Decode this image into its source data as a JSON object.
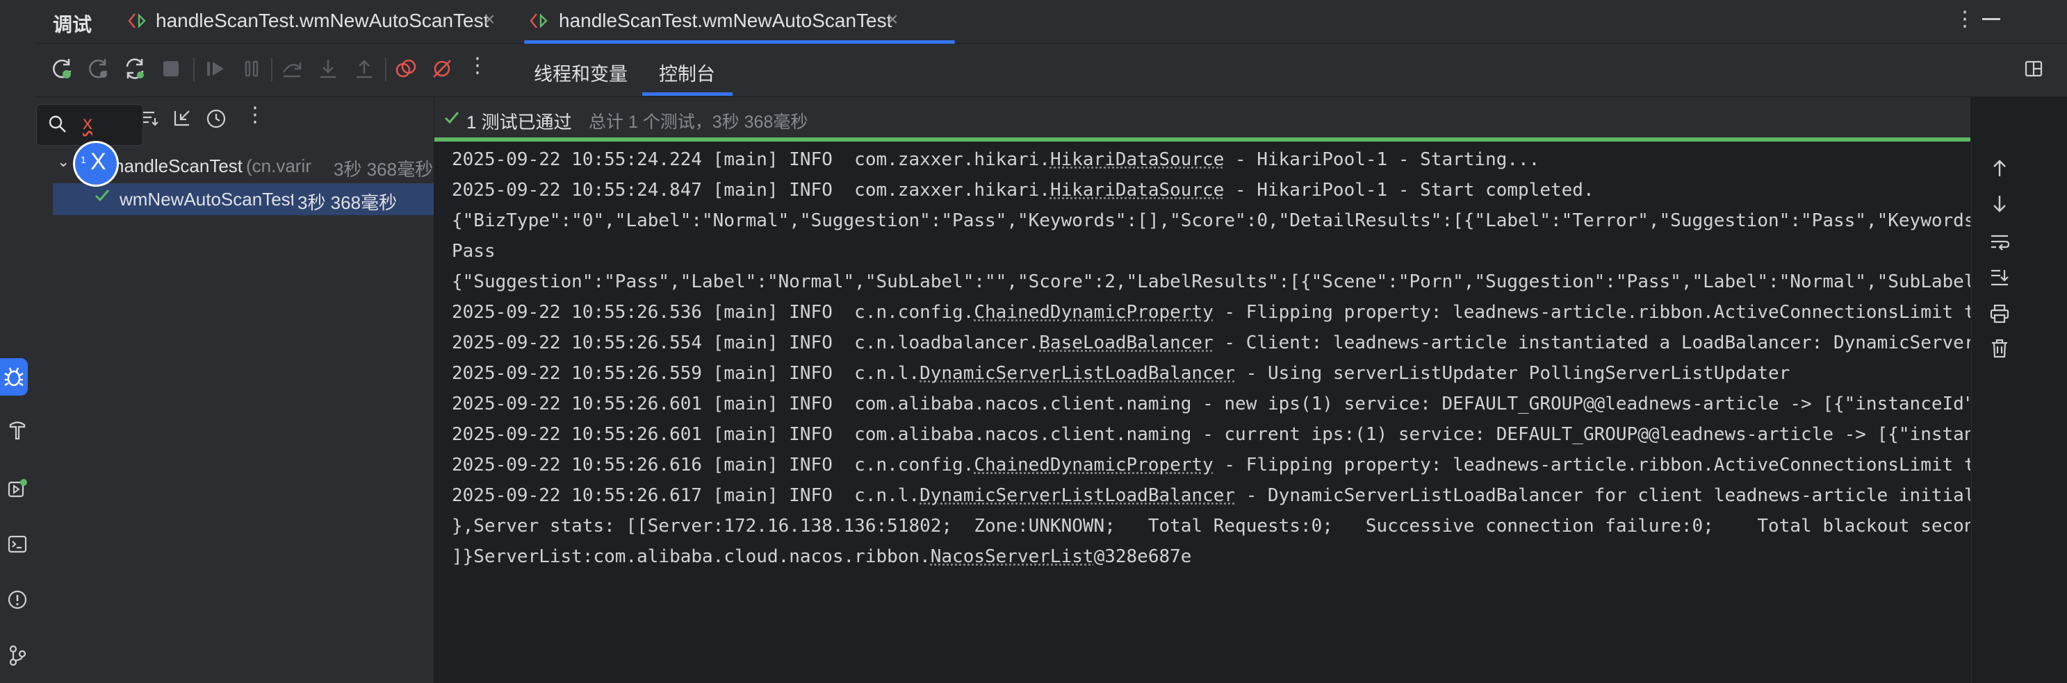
{
  "tabs": {
    "debug_label": "调试",
    "items": [
      {
        "label": "handleScanTest.wmNewAutoScanTest",
        "active": false
      },
      {
        "label": "handleScanTest.wmNewAutoScanTest",
        "active": true
      }
    ]
  },
  "toolbar": {
    "tabs": [
      {
        "label": "线程和变量",
        "active": false
      },
      {
        "label": "控制台",
        "active": true
      }
    ]
  },
  "search": {
    "value": "x"
  },
  "badge": {
    "count": "1",
    "label": "X"
  },
  "tree": {
    "root": {
      "name": "handleScanTest",
      "package": "(cn.varir",
      "time": "3秒 368毫秒"
    },
    "child": {
      "name": "wmNewAutoScanTest",
      "time": "3秒 368毫秒"
    }
  },
  "status": {
    "passed": "1 测试已通过",
    "summary": "总计 1 个测试，3秒 368毫秒"
  },
  "console": {
    "lines": [
      {
        "pre": "2025-09-22 10:55:24.224 [main] INFO  com.zaxxer.hikari.",
        "link": "HikariDataSource",
        "post": " - HikariPool-1 - Starting..."
      },
      {
        "pre": "2025-09-22 10:55:24.847 [main] INFO  com.zaxxer.hikari.",
        "link": "HikariDataSource",
        "post": " - HikariPool-1 - Start completed."
      },
      {
        "pre": "{\"BizType\":\"0\",\"Label\":\"Normal\",\"Suggestion\":\"Pass\",\"Keywords\":[],\"Score\":0,\"DetailResults\":[{\"Label\":\"Terror\",\"Suggestion\":\"Pass\",\"Keywords",
        "link": "",
        "post": ""
      },
      {
        "pre": "Pass",
        "link": "",
        "post": ""
      },
      {
        "pre": "{\"Suggestion\":\"Pass\",\"Label\":\"Normal\",\"SubLabel\":\"\",\"Score\":2,\"LabelResults\":[{\"Scene\":\"Porn\",\"Suggestion\":\"Pass\",\"Label\":\"Normal\",\"SubLabel",
        "link": "",
        "post": ""
      },
      {
        "pre": "2025-09-22 10:55:26.536 [main] INFO  c.n.config.",
        "link": "ChainedDynamicProperty",
        "post": " - Flipping property: leadnews-article.ribbon.ActiveConnectionsLimit t"
      },
      {
        "pre": "2025-09-22 10:55:26.554 [main] INFO  c.n.loadbalancer.",
        "link": "BaseLoadBalancer",
        "post": " - Client: leadnews-article instantiated a LoadBalancer: DynamicServer"
      },
      {
        "pre": "2025-09-22 10:55:26.559 [main] INFO  c.n.l.",
        "link": "DynamicServerListLoadBalancer",
        "post": " - Using serverListUpdater PollingServerListUpdater"
      },
      {
        "pre": "2025-09-22 10:55:26.601 [main] INFO  com.alibaba.nacos.client.naming - new ips(1) service: DEFAULT_GROUP@@leadnews-article -> [{\"instanceId\"",
        "link": "",
        "post": ""
      },
      {
        "pre": "2025-09-22 10:55:26.601 [main] INFO  com.alibaba.nacos.client.naming - current ips:(1) service: DEFAULT_GROUP@@leadnews-article -> [{\"instan",
        "link": "",
        "post": ""
      },
      {
        "pre": "2025-09-22 10:55:26.616 [main] INFO  c.n.config.",
        "link": "ChainedDynamicProperty",
        "post": " - Flipping property: leadnews-article.ribbon.ActiveConnectionsLimit t"
      },
      {
        "pre": "2025-09-22 10:55:26.617 [main] INFO  c.n.l.",
        "link": "DynamicServerListLoadBalancer",
        "post": " - DynamicServerListLoadBalancer for client leadnews-article initial"
      },
      {
        "pre": "},Server stats: [[Server:172.16.138.136:51802;  Zone:UNKNOWN;   Total Requests:0;   Successive connection failure:0;    Total blackout secon",
        "link": "",
        "post": ""
      },
      {
        "pre": "]}ServerList:com.alibaba.cloud.nacos.ribbon.",
        "link": "NacosServerList",
        "post": "@328e687e"
      }
    ]
  },
  "colors": {
    "accent": "#3574f0",
    "pass_green": "#5fb865",
    "stop_red": "#e5534b",
    "bg": "#1e1f22",
    "panel": "#2b2d30"
  }
}
